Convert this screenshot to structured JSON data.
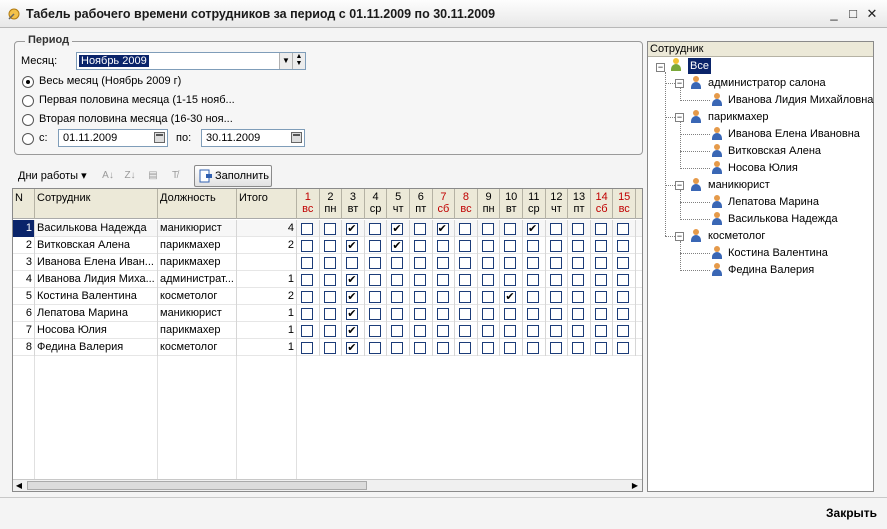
{
  "window": {
    "title": "Табель рабочего времени сотрудников за период с 01.11.2009 по 30.11.2009",
    "minimize": "_",
    "maximize": "□",
    "close": "✕"
  },
  "period": {
    "legend": "Период",
    "month_label": "Месяц:",
    "month_value": "Ноябрь 2009",
    "options": [
      {
        "label": "Весь месяц (Ноябрь 2009 г)",
        "selected": true
      },
      {
        "label": "Первая половина месяца (1-15 нояб...",
        "selected": false
      },
      {
        "label": "Вторая половина месяца (16-30 ноя...",
        "selected": false
      }
    ],
    "from_label": "с:",
    "from_value": "01.11.2009",
    "to_label": "по:",
    "to_value": "30.11.2009"
  },
  "toolbar": {
    "workdays_label": "Дни работы",
    "fill_label": "Заполнить"
  },
  "grid": {
    "columns": {
      "n": "N",
      "employee": "Сотрудник",
      "position": "Должность",
      "total": "Итого"
    },
    "days": [
      {
        "d": "1",
        "w": "вс",
        "red": true
      },
      {
        "d": "2",
        "w": "пн",
        "red": false
      },
      {
        "d": "3",
        "w": "вт",
        "red": false
      },
      {
        "d": "4",
        "w": "ср",
        "red": false
      },
      {
        "d": "5",
        "w": "чт",
        "red": false
      },
      {
        "d": "6",
        "w": "пт",
        "red": false
      },
      {
        "d": "7",
        "w": "сб",
        "red": true
      },
      {
        "d": "8",
        "w": "вс",
        "red": true
      },
      {
        "d": "9",
        "w": "пн",
        "red": false
      },
      {
        "d": "10",
        "w": "вт",
        "red": false
      },
      {
        "d": "11",
        "w": "ср",
        "red": false
      },
      {
        "d": "12",
        "w": "чт",
        "red": false
      },
      {
        "d": "13",
        "w": "пт",
        "red": false
      },
      {
        "d": "14",
        "w": "сб",
        "red": true
      },
      {
        "d": "15",
        "w": "вс",
        "red": true
      }
    ],
    "rows": [
      {
        "n": "1",
        "name": "Василькова Надежда",
        "pos": "маникюрист",
        "total": "4",
        "checks": [
          0,
          0,
          1,
          0,
          1,
          0,
          1,
          0,
          0,
          0,
          1,
          0,
          0,
          0,
          0
        ]
      },
      {
        "n": "2",
        "name": "Витковская Алена",
        "pos": "парикмахер",
        "total": "2",
        "checks": [
          0,
          0,
          1,
          0,
          1,
          0,
          0,
          0,
          0,
          0,
          0,
          0,
          0,
          0,
          0
        ]
      },
      {
        "n": "3",
        "name": "Иванова Елена Иван...",
        "pos": "парикмахер",
        "total": "",
        "checks": [
          0,
          0,
          0,
          0,
          0,
          0,
          0,
          0,
          0,
          0,
          0,
          0,
          0,
          0,
          0
        ]
      },
      {
        "n": "4",
        "name": "Иванова Лидия Миха...",
        "pos": "администрат...",
        "total": "1",
        "checks": [
          0,
          0,
          1,
          0,
          0,
          0,
          0,
          0,
          0,
          0,
          0,
          0,
          0,
          0,
          0
        ]
      },
      {
        "n": "5",
        "name": "Костина Валентина",
        "pos": "косметолог",
        "total": "2",
        "checks": [
          0,
          0,
          1,
          0,
          0,
          0,
          0,
          0,
          0,
          1,
          0,
          0,
          0,
          0,
          0
        ]
      },
      {
        "n": "6",
        "name": "Лепатова Марина",
        "pos": "маникюрист",
        "total": "1",
        "checks": [
          0,
          0,
          1,
          0,
          0,
          0,
          0,
          0,
          0,
          0,
          0,
          0,
          0,
          0,
          0
        ]
      },
      {
        "n": "7",
        "name": "Носова Юлия",
        "pos": "парикмахер",
        "total": "1",
        "checks": [
          0,
          0,
          1,
          0,
          0,
          0,
          0,
          0,
          0,
          0,
          0,
          0,
          0,
          0,
          0
        ]
      },
      {
        "n": "8",
        "name": "Федина Валерия",
        "pos": "косметолог",
        "total": "1",
        "checks": [
          0,
          0,
          1,
          0,
          0,
          0,
          0,
          0,
          0,
          0,
          0,
          0,
          0,
          0,
          0
        ]
      }
    ]
  },
  "tree": {
    "header": "Сотрудник",
    "root": "Все",
    "groups": [
      {
        "name": "администратор салона",
        "members": [
          "Иванова Лидия Михайловна"
        ]
      },
      {
        "name": "парикмахер",
        "members": [
          "Иванова Елена Ивановна",
          "Витковская Алена",
          "Носова Юлия"
        ]
      },
      {
        "name": "маникюрист",
        "members": [
          "Лепатова Марина",
          "Василькова Надежда"
        ]
      },
      {
        "name": "косметолог",
        "members": [
          "Костина Валентина",
          "Федина Валерия"
        ]
      }
    ]
  },
  "footer": {
    "close_label": "Закрыть"
  }
}
